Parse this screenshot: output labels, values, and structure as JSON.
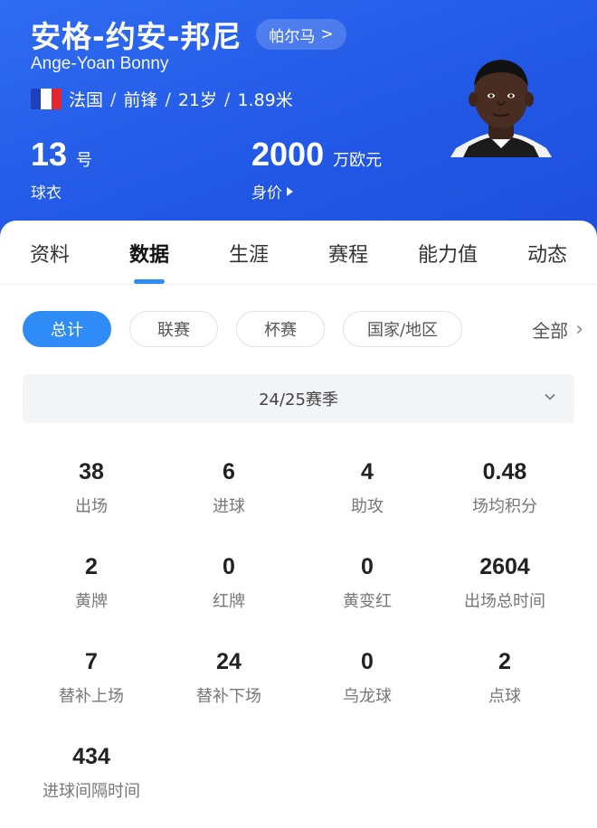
{
  "player": {
    "cn_name": "安格-约安-邦尼",
    "club": "帕尔马",
    "club_arrow": ">",
    "en_name": "Ange-Yoan Bonny",
    "nationality": "法国",
    "position": "前锋",
    "age": "21岁",
    "height": "1.89米",
    "separator": "/",
    "shirt_number": "13",
    "shirt_unit": "号",
    "shirt_label": "球衣",
    "value": "2000",
    "value_unit": "万欧元",
    "value_label": "身价",
    "flag_colors": [
      "#1f3fbf",
      "#ffffff",
      "#e3262f"
    ]
  },
  "tabs": [
    "资料",
    "数据",
    "生涯",
    "赛程",
    "能力值",
    "动态"
  ],
  "active_tab": "数据",
  "filters": {
    "chips": [
      "总计",
      "联赛",
      "杯赛",
      "国家/地区"
    ],
    "active": "总计",
    "all_label": "全部",
    "all_chevron": "›"
  },
  "season": {
    "label": "24/25赛季"
  },
  "stats": [
    {
      "value": "38",
      "label": "出场"
    },
    {
      "value": "6",
      "label": "进球"
    },
    {
      "value": "4",
      "label": "助攻"
    },
    {
      "value": "0.48",
      "label": "场均积分"
    },
    {
      "value": "2",
      "label": "黄牌"
    },
    {
      "value": "0",
      "label": "红牌"
    },
    {
      "value": "0",
      "label": "黄变红"
    },
    {
      "value": "2604",
      "label": "出场总时间"
    },
    {
      "value": "7",
      "label": "替补上场"
    },
    {
      "value": "24",
      "label": "替补下场"
    },
    {
      "value": "0",
      "label": "乌龙球"
    },
    {
      "value": "2",
      "label": "点球"
    },
    {
      "value": "434",
      "label": "进球间隔时间"
    }
  ],
  "colors": {
    "header_blue": "#2258e6",
    "accent": "#2f8cf6"
  }
}
